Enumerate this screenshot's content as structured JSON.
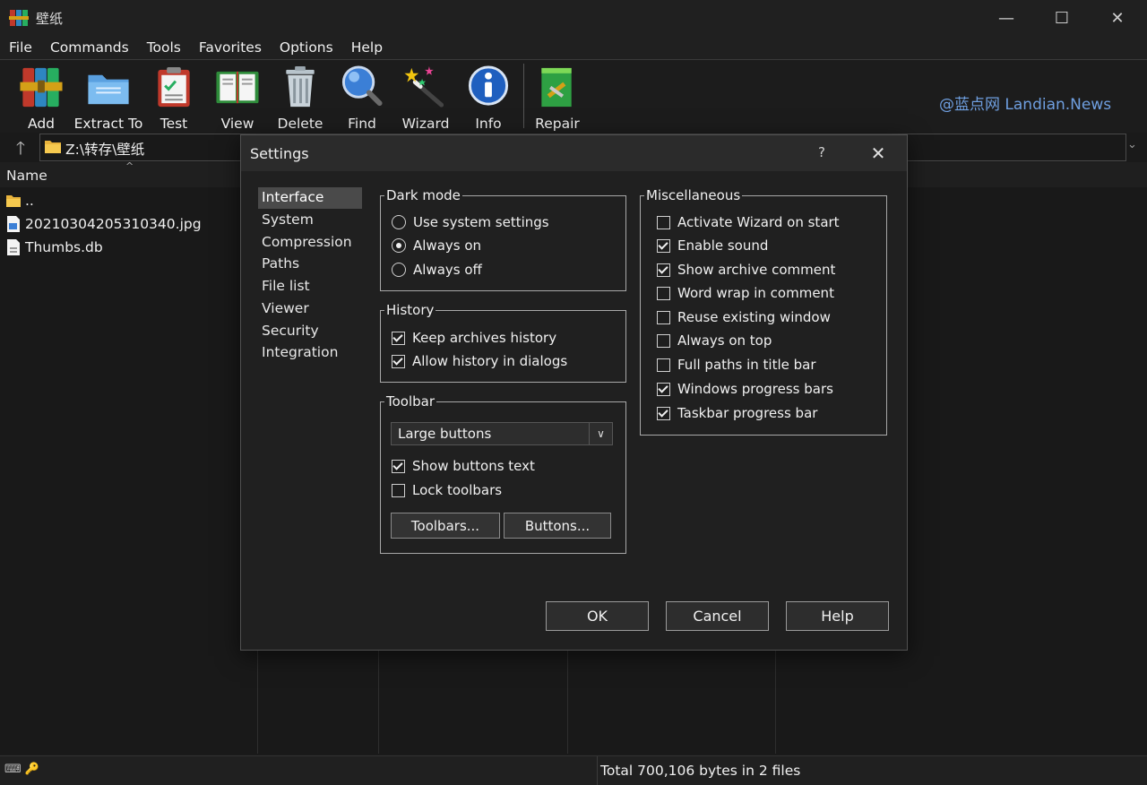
{
  "window": {
    "title": "壁纸",
    "minimize": "—",
    "maximize": "☐",
    "close": "✕"
  },
  "menu": [
    "File",
    "Commands",
    "Tools",
    "Favorites",
    "Options",
    "Help"
  ],
  "toolbar": {
    "buttons": [
      {
        "label": "Add",
        "icon": "archive-books-icon"
      },
      {
        "label": "Extract To",
        "icon": "folder-icon"
      },
      {
        "label": "Test",
        "icon": "clipboard-check-icon"
      },
      {
        "label": "View",
        "icon": "book-icon"
      },
      {
        "label": "Delete",
        "icon": "trash-icon"
      },
      {
        "label": "Find",
        "icon": "magnifier-icon"
      },
      {
        "label": "Wizard",
        "icon": "magic-wand-icon"
      },
      {
        "label": "Info",
        "icon": "info-icon"
      },
      {
        "label": "Repair",
        "icon": "repair-box-icon"
      }
    ]
  },
  "watermark": "@蓝点网 Landian.News",
  "address": {
    "path": "Z:\\转存\\壁纸",
    "up": "🡑"
  },
  "filelist": {
    "column_name": "Name",
    "sort_indicator": "^",
    "rows": [
      {
        "name": "..",
        "icon": "folder-icon"
      },
      {
        "name": "20210304205310340.jpg",
        "icon": "image-file-icon"
      },
      {
        "name": "Thumbs.db",
        "icon": "file-icon"
      }
    ]
  },
  "status": {
    "text": "Total 700,106 bytes in 2 files"
  },
  "dialog": {
    "title": "Settings",
    "help_glyph": "?",
    "close_glyph": "✕",
    "nav": [
      "Interface",
      "System",
      "Compression",
      "Paths",
      "File list",
      "Viewer",
      "Security",
      "Integration"
    ],
    "nav_selected": 0,
    "dark_mode": {
      "legend": "Dark mode",
      "options": [
        {
          "label": "Use system settings",
          "checked": false
        },
        {
          "label": "Always on",
          "checked": true
        },
        {
          "label": "Always off",
          "checked": false
        }
      ]
    },
    "history": {
      "legend": "History",
      "options": [
        {
          "label": "Keep archives history",
          "checked": true
        },
        {
          "label": "Allow history in dialogs",
          "checked": true
        }
      ]
    },
    "toolbar_group": {
      "legend": "Toolbar",
      "select_value": "Large buttons",
      "options": [
        {
          "label": "Show buttons text",
          "checked": true
        },
        {
          "label": "Lock toolbars",
          "checked": false
        }
      ],
      "toolbars_button": "Toolbars...",
      "buttons_button": "Buttons..."
    },
    "misc": {
      "legend": "Miscellaneous",
      "options": [
        {
          "label": "Activate Wizard on start",
          "checked": false
        },
        {
          "label": "Enable sound",
          "checked": true
        },
        {
          "label": "Show archive comment",
          "checked": true
        },
        {
          "label": "Word wrap in comment",
          "checked": false
        },
        {
          "label": "Reuse existing window",
          "checked": false
        },
        {
          "label": "Always on top",
          "checked": false
        },
        {
          "label": "Full paths in title bar",
          "checked": false
        },
        {
          "label": "Windows progress bars",
          "checked": true
        },
        {
          "label": "Taskbar progress bar",
          "checked": true
        }
      ]
    },
    "ok": "OK",
    "cancel": "Cancel",
    "help": "Help"
  }
}
